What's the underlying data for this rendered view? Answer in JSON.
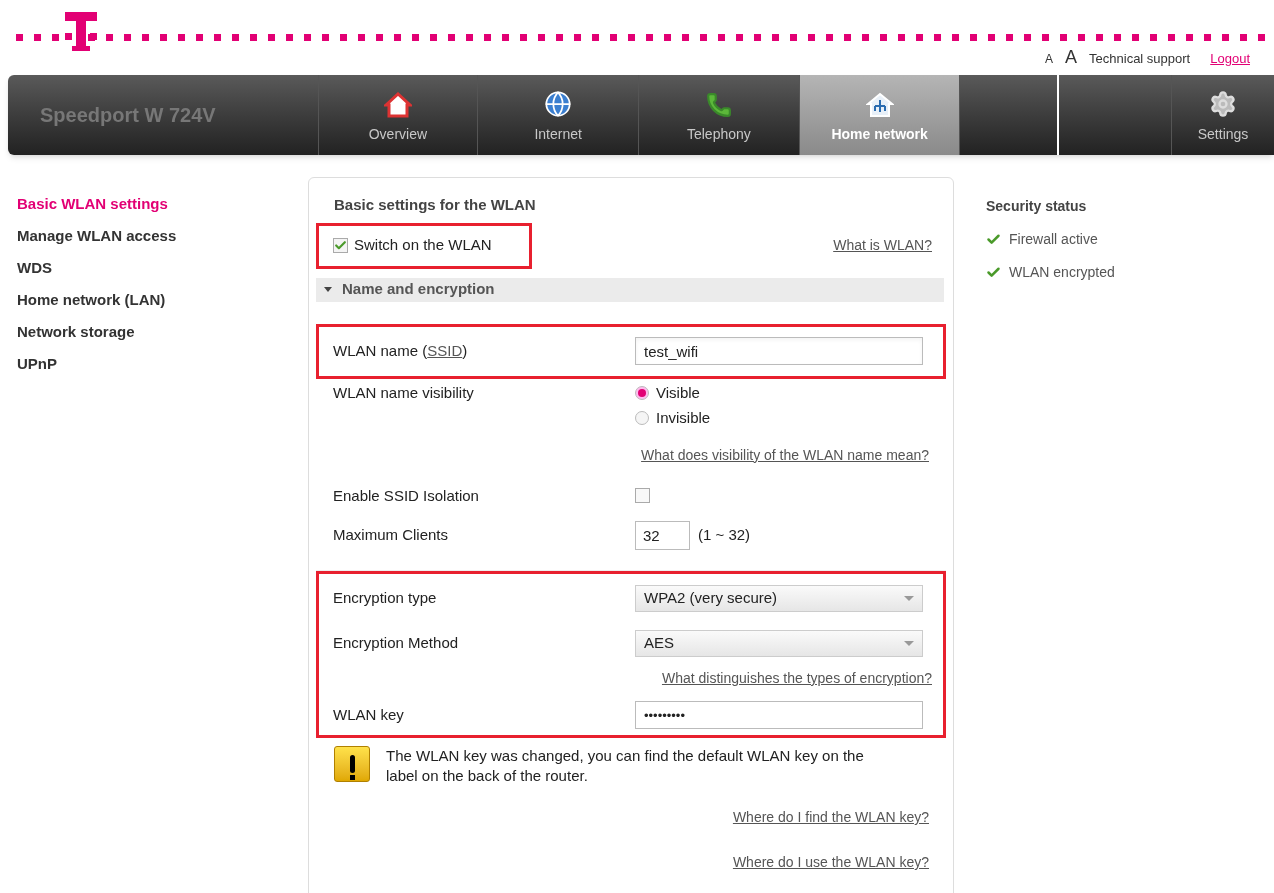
{
  "header": {
    "font_sizes": [
      "A",
      "A"
    ],
    "links": [
      {
        "label": "Technical support",
        "kind": "plain"
      },
      {
        "label": "Logout",
        "kind": "accent"
      }
    ]
  },
  "nav": {
    "brand": "Speedport W 724V",
    "tabs": [
      {
        "label": "Overview",
        "selected": false
      },
      {
        "label": "Internet",
        "selected": false
      },
      {
        "label": "Telephony",
        "selected": false
      },
      {
        "label": "Home network",
        "selected": true
      }
    ],
    "settings": {
      "label": "Settings",
      "selected": false
    }
  },
  "sidebar": {
    "items": [
      {
        "label": "Basic WLAN settings",
        "selected": true
      },
      {
        "label": "Manage WLAN access",
        "selected": false
      },
      {
        "label": "WDS",
        "selected": false
      },
      {
        "label": "Home network (LAN)",
        "selected": false
      },
      {
        "label": "Network storage",
        "selected": false
      },
      {
        "label": "UPnP",
        "selected": false
      }
    ]
  },
  "form": {
    "title": "Basic settings for the WLAN",
    "rows": [
      {
        "kind": "switch",
        "label": "Switch on the WLAN",
        "checked": true,
        "link": "What is WLAN?",
        "highlighted": true
      },
      {
        "kind": "section",
        "label": "Name and encryption",
        "expanded": true
      },
      {
        "kind": "text",
        "label_parts": [
          "WLAN name (",
          "SSID",
          ")"
        ],
        "value": "test_wifi",
        "highlighted": true
      },
      {
        "kind": "radio",
        "label": "WLAN name visibility",
        "options": [
          {
            "label": "Visible",
            "selected": true
          },
          {
            "label": "Invisible",
            "selected": false
          }
        ]
      },
      {
        "kind": "link",
        "link": "What does visibility of the WLAN name mean?"
      },
      {
        "kind": "checkbox",
        "label": "Enable SSID Isolation",
        "checked": false
      },
      {
        "kind": "number",
        "label": "Maximum Clients",
        "value": "32",
        "hint": "(1 ~ 32)"
      },
      {
        "kind": "select",
        "label": "Encryption type",
        "value": "WPA2 (very secure)",
        "highlighted": true
      },
      {
        "kind": "select",
        "label": "Encryption Method",
        "value": "AES",
        "highlighted": true
      },
      {
        "kind": "link",
        "link": "What distinguishes the types of encryption?",
        "highlighted": true
      },
      {
        "kind": "password",
        "label": "WLAN key",
        "value": "•••••••••",
        "highlighted": true
      },
      {
        "kind": "notice",
        "text": "The WLAN key was changed, you can find the default WLAN key on the label on the back of the router."
      },
      {
        "kind": "link",
        "link": "Where do I find the WLAN key?"
      },
      {
        "kind": "link",
        "link": "Where do I use the WLAN key?"
      }
    ]
  },
  "security": {
    "title": "Security status",
    "items": [
      {
        "label": "Firewall active",
        "ok": true
      },
      {
        "label": "WLAN encrypted",
        "ok": true
      }
    ]
  }
}
